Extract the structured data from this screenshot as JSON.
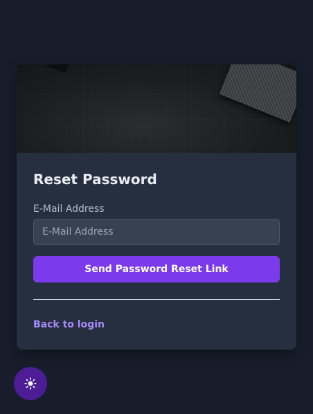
{
  "card": {
    "title": "Reset Password",
    "email_label": "E-Mail Address",
    "email_placeholder": "E-Mail Address",
    "email_value": "",
    "submit_label": "Send Password Reset Link",
    "back_link": "Back to login"
  },
  "theme_toggle": {
    "icon": "sun-icon"
  },
  "colors": {
    "page_bg": "#171d2b",
    "card_bg": "#252f3f",
    "accent": "#7c3aed",
    "link": "#a78bfa",
    "toggle_bg": "#4c1d95"
  }
}
